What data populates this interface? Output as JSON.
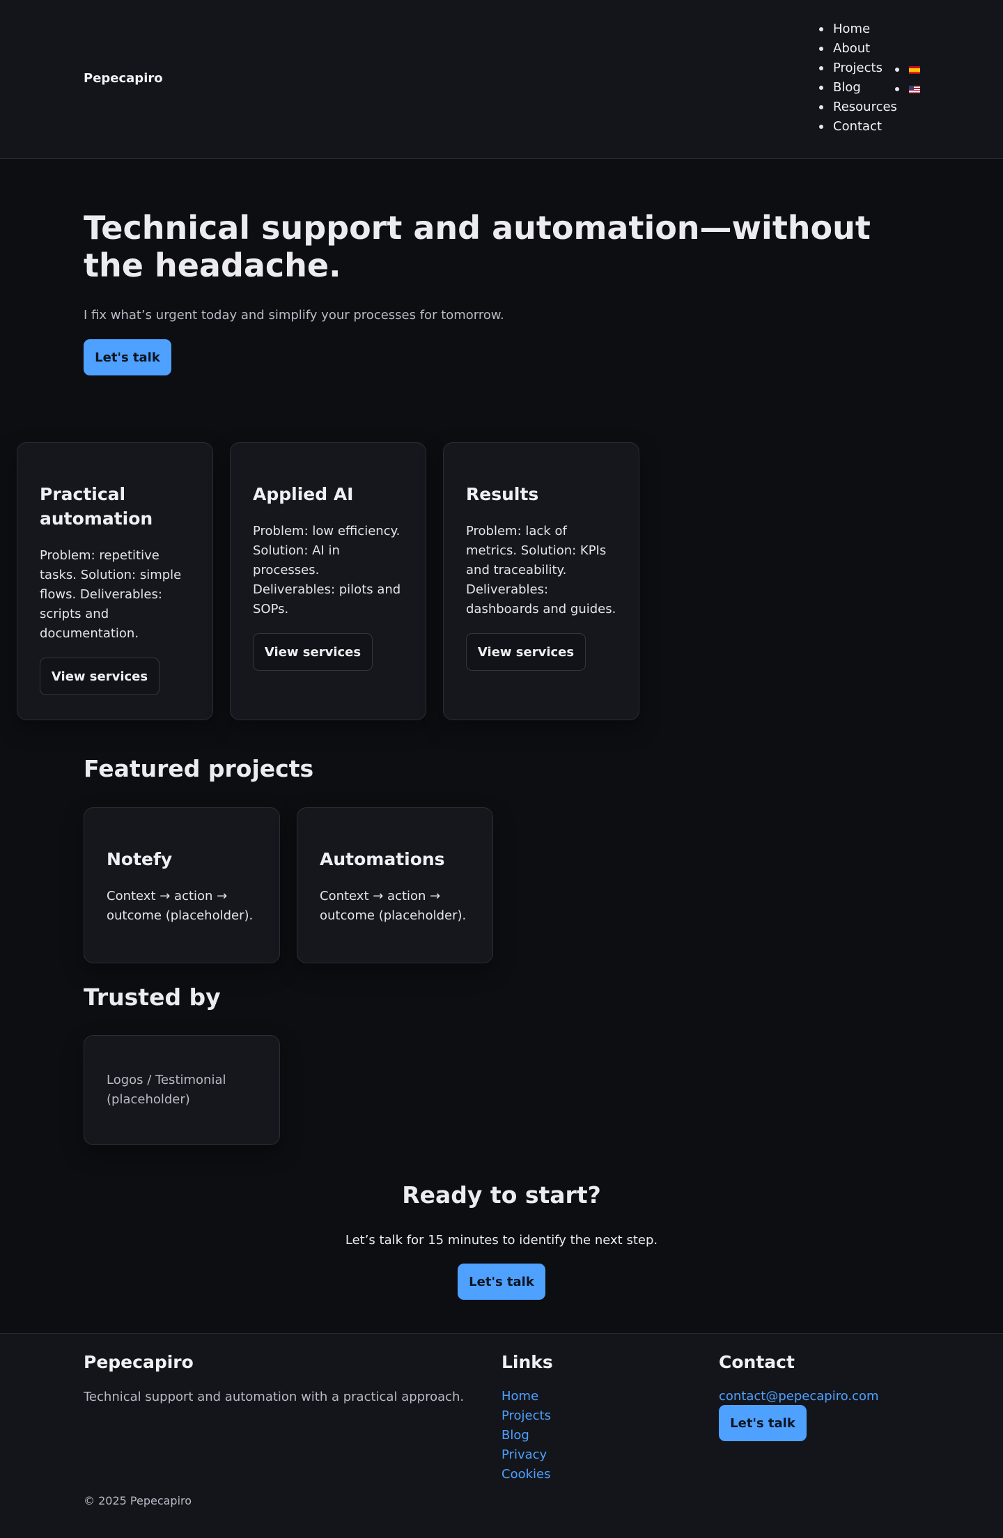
{
  "header": {
    "brand": "Pepecapiro",
    "nav": [
      "Home",
      "About",
      "Projects",
      "Blog",
      "Resources",
      "Contact"
    ],
    "languages": [
      {
        "icon": "spain-flag-icon"
      },
      {
        "icon": "us-flag-icon"
      }
    ]
  },
  "hero": {
    "title": "Technical support and automation—without the headache.",
    "subtitle": "I fix what’s urgent today and simplify your processes for tomorrow.",
    "cta": "Let's talk"
  },
  "services": [
    {
      "title": "Practical automation",
      "text": "Problem: repetitive tasks. Solution: simple flows. Deliverables: scripts and documentation.",
      "button": "View services"
    },
    {
      "title": "Applied AI",
      "text": "Problem: low efficiency. Solution: AI in processes. Deliverables: pilots and SOPs.",
      "button": "View services"
    },
    {
      "title": "Results",
      "text": "Problem: lack of metrics. Solution: KPIs and traceability. Deliverables: dashboards and guides.",
      "button": "View services"
    }
  ],
  "projects": {
    "title": "Featured projects",
    "items": [
      {
        "title": "Notefy",
        "text": "Context → action → outcome (placeholder)."
      },
      {
        "title": "Automations",
        "text": "Context → action → outcome (placeholder)."
      }
    ]
  },
  "trusted": {
    "title": "Trusted by",
    "text": "Logos / Testimonial (placeholder)"
  },
  "cta": {
    "title": "Ready to start?",
    "subtitle": "Let’s talk for 15 minutes to identify the next step.",
    "button": "Let's talk"
  },
  "footer": {
    "brand": "Pepecapiro",
    "description": "Technical support and automation with a practical approach.",
    "links_title": "Links",
    "links": [
      "Home",
      "Projects",
      "Blog",
      "Privacy",
      "Cookies"
    ],
    "contact_title": "Contact",
    "email": "contact@pepecapiro.com",
    "contact_button": "Let's talk",
    "copyright": "© 2025 Pepecapiro"
  },
  "colors": {
    "accent": "#4ea1ff",
    "background": "#0d0e12",
    "surface": "#16171d"
  }
}
